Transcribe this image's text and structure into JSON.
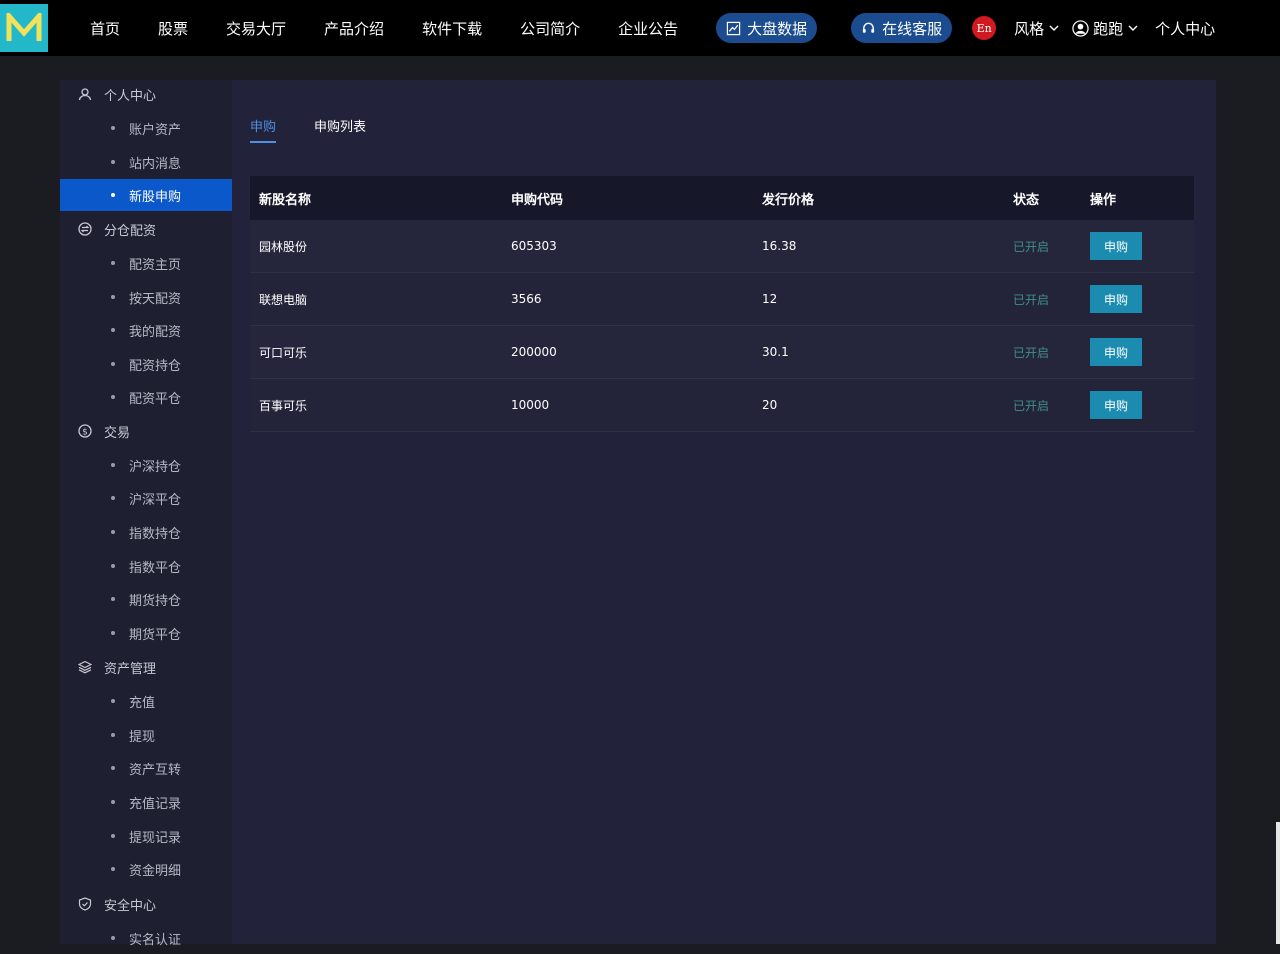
{
  "nav": {
    "items": [
      "首页",
      "股票",
      "交易大厅",
      "产品介绍",
      "软件下载",
      "公司简介",
      "企业公告"
    ],
    "big_data": "大盘数据",
    "service": "在线客服",
    "lang": "En",
    "style": "风格",
    "user": "跑跑",
    "personal_center": "个人中心"
  },
  "sidebar": {
    "groups": [
      {
        "title": "个人中心",
        "icon": "user-icon",
        "items": [
          "账户资产",
          "站内消息",
          "新股申购"
        ]
      },
      {
        "title": "分仓配资",
        "icon": "exchange-icon",
        "items": [
          "配资主页",
          "按天配资",
          "我的配资",
          "配资持仓",
          "配资平仓"
        ]
      },
      {
        "title": "交易",
        "icon": "dollar-icon",
        "items": [
          "沪深持仓",
          "沪深平仓",
          "指数持仓",
          "指数平仓",
          "期货持仓",
          "期货平仓"
        ]
      },
      {
        "title": "资产管理",
        "icon": "layers-icon",
        "items": [
          "充值",
          "提现",
          "资产互转",
          "充值记录",
          "提现记录",
          "资金明细"
        ]
      },
      {
        "title": "安全中心",
        "icon": "shield-icon",
        "items": [
          "实名认证"
        ]
      }
    ],
    "active_item": "新股申购"
  },
  "tabs": [
    "申购",
    "申购列表"
  ],
  "table": {
    "headers": [
      "新股名称",
      "申购代码",
      "发行价格",
      "状态",
      "操作"
    ],
    "rows": [
      {
        "name": "园林股份",
        "code": "605303",
        "price": "16.38",
        "status": "已开启",
        "action": "申购"
      },
      {
        "name": "联想电脑",
        "code": "3566",
        "price": "12",
        "status": "已开启",
        "action": "申购"
      },
      {
        "name": "可口可乐",
        "code": "200000",
        "price": "30.1",
        "status": "已开启",
        "action": "申购"
      },
      {
        "name": "百事可乐",
        "code": "10000",
        "price": "20",
        "status": "已开启",
        "action": "申购"
      }
    ]
  },
  "colors": {
    "accent": "#0a58ca",
    "button": "#1b8cb0",
    "status": "#3f8f87",
    "logo": "#22b8c9"
  }
}
